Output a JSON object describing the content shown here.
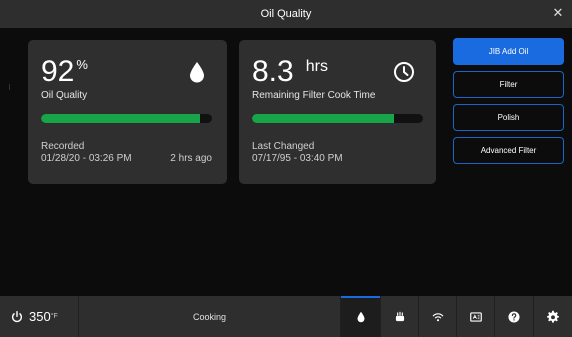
{
  "window": {
    "title": "Oil Quality",
    "close_icon": "close-icon"
  },
  "oil_card": {
    "value": "92",
    "unit": "%",
    "label": "Oil Quality",
    "icon": "drop-icon",
    "progress": 0.93,
    "recorded_label": "Recorded",
    "recorded_time": "01/28/20 - 03:26 PM",
    "ago": "2 hrs ago"
  },
  "filter_card": {
    "value": "8.3",
    "unit": "hrs",
    "label": "Remaining Filter Cook Time",
    "icon": "clock-icon",
    "progress": 0.83,
    "changed_label": "Last Changed",
    "changed_time": "07/17/95 - 03:40 PM"
  },
  "actions": [
    {
      "label": "JIB Add Oil",
      "primary": true
    },
    {
      "label": "Filter",
      "primary": false
    },
    {
      "label": "Polish",
      "primary": false
    },
    {
      "label": "Advanced Filter",
      "primary": false
    }
  ],
  "footer": {
    "temperature": "350",
    "temp_unit": "°F",
    "status": "Cooking",
    "icons": [
      "power-icon",
      "drop-icon",
      "fryer-icon",
      "wifi-icon",
      "screen-icon",
      "help-icon",
      "gear-icon"
    ]
  },
  "colors": {
    "accent": "#1a6be0",
    "progress": "#18a54a",
    "card": "#2f2f2f"
  }
}
